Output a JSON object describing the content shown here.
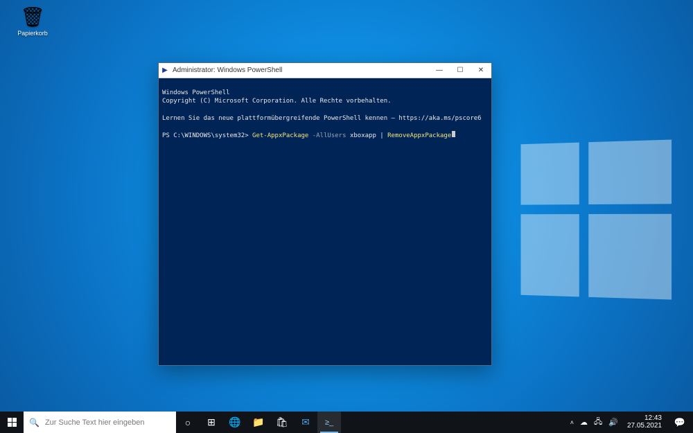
{
  "desktop": {
    "recycle_bin_label": "Papierkorb",
    "recycle_bin_icon": "🗑"
  },
  "window": {
    "title": "Administrator: Windows PowerShell",
    "icon_name": "powershell-icon",
    "minimize": "—",
    "maximize": "☐",
    "close": "✕"
  },
  "terminal": {
    "line1": "Windows PowerShell",
    "line2": "Copyright (C) Microsoft Corporation. Alle Rechte vorbehalten.",
    "line3": "Lernen Sie das neue plattformübergreifende PowerShell kennen – https://aka.ms/pscore6",
    "prompt": "PS C:\\WINDOWS\\system32> ",
    "cmd_part1": "Get-AppxPackage",
    "cmd_flag": " -AllUsers ",
    "cmd_arg": "xboxapp",
    "cmd_pipe": " | ",
    "cmd_part2": "RemoveAppxPackage"
  },
  "taskbar": {
    "search_placeholder": "Zur Suche Text hier eingeben",
    "icons": {
      "cortana": "○",
      "taskview": "⊞",
      "edge": "🌐",
      "explorer": "📁",
      "store": "🛍",
      "mail": "✉",
      "powershell": "≥_"
    },
    "tray": {
      "chevron": "˄",
      "onedrive": "☁",
      "network": "🖧",
      "sound": "🔊",
      "time": "12:43",
      "date": "27.05.2021",
      "notifications": "💬"
    }
  }
}
